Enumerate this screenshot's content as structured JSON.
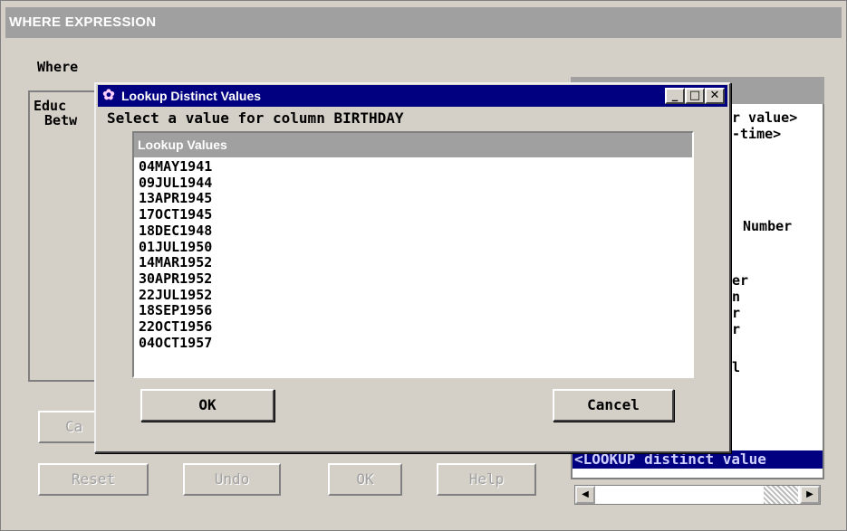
{
  "parent": {
    "title": "WHERE EXPRESSION",
    "where_label": "Where",
    "expr_lines": [
      "Educ",
      "Betw"
    ],
    "right_panel": {
      "lines": [
        "r value>",
        "-time>",
        "Number",
        "er",
        "n",
        "r",
        "r",
        "l"
      ],
      "selected": "<LOOKUP distinct value"
    },
    "buttons": {
      "partial": "Ca",
      "reset": "Reset",
      "undo": "Undo",
      "ok": "OK",
      "help": "Help"
    }
  },
  "dialog": {
    "title": "Lookup Distinct Values",
    "prompt": "Select a value for column BIRTHDAY",
    "list_header": "Lookup Values",
    "values": [
      "04MAY1941",
      "09JUL1944",
      "13APR1945",
      "17OCT1945",
      "18DEC1948",
      "01JUL1950",
      "14MAR1952",
      "30APR1952",
      "22JUL1952",
      "18SEP1956",
      "22OCT1956",
      "04OCT1957"
    ],
    "ok_label": "OK",
    "cancel_label": "Cancel",
    "controls": {
      "minimize": "_",
      "maximize": "□",
      "close": "✕"
    }
  },
  "icons": {
    "window_icon": "sas-app-icon",
    "scroll_left": "◀",
    "scroll_right": "▶"
  },
  "colors": {
    "title_active": "#000080",
    "title_inactive": "#a0a0a0",
    "face": "#d4d0c8"
  }
}
